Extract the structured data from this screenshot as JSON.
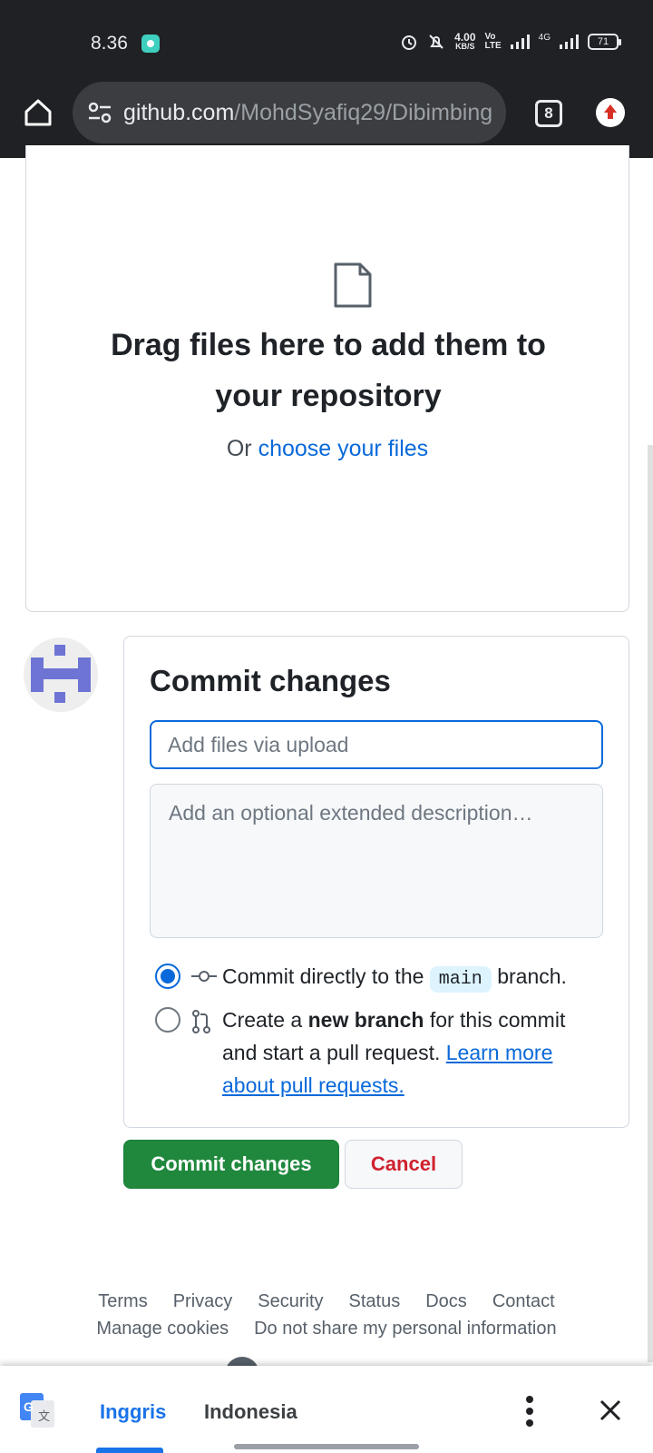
{
  "status_bar": {
    "time": "8.36",
    "net_speed_value": "4.00",
    "net_speed_unit": "KB/S",
    "volte_top": "Vo",
    "volte_bottom": "LTE",
    "network_label": "4G",
    "battery": "71"
  },
  "browser": {
    "url_domain": "github.com",
    "url_path": "/MohdSyafiq29/Dibimbing",
    "tab_count": "8"
  },
  "dropzone": {
    "title": "Drag files here to add them to your repository",
    "or_text": "Or",
    "choose_link": "choose your files"
  },
  "commit": {
    "heading": "Commit changes",
    "summary_placeholder": "Add files via upload",
    "description_placeholder": "Add an optional extended description…",
    "option_direct": {
      "prefix": "Commit directly to the",
      "branch": "main",
      "suffix": "branch.",
      "selected": true
    },
    "option_new_branch": {
      "prefix": "Create a",
      "bold": "new branch",
      "suffix": "for this commit and start a pull request.",
      "link": "Learn more about pull requests.",
      "selected": false
    },
    "submit_label": "Commit changes",
    "cancel_label": "Cancel"
  },
  "footer": {
    "links_row1": [
      "Terms",
      "Privacy",
      "Security",
      "Status",
      "Docs",
      "Contact"
    ],
    "links_row2": [
      "Manage cookies",
      "Do not share my personal information"
    ]
  },
  "translate_bar": {
    "source_language": "Inggris",
    "target_language": "Indonesia"
  },
  "colors": {
    "accent_blue": "#0969da",
    "commit_green": "#1f883d",
    "cancel_red": "#cf222e",
    "avatar_purple": "#6e74d4"
  }
}
